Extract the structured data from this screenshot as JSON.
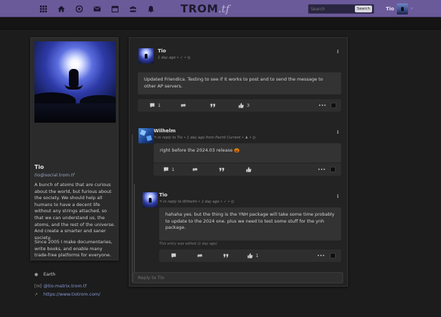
{
  "header": {
    "logo_main": "TROM",
    "logo_tld": ".tf",
    "nav_icons": [
      "grid-icon",
      "home-icon",
      "network-icon",
      "envelope-icon",
      "calendar-icon",
      "users-icon",
      "bell-icon"
    ],
    "search_placeholder": "Search",
    "search_button": "Search",
    "user_name": "Tio"
  },
  "profile": {
    "name": "Tio",
    "handle": "tio@social.trom.tf",
    "bio": "A bunch of atoms that are curious about the world, but furious about the society. We should help all humans to have a decent life without any strings attached, so that we can understand us, the atoms, and the rest of the universe. And create a smarter and saner society.",
    "bio2": "Since 2005 I make documentaries, write books, and enable many trade-free platforms for everyone.",
    "location": "Earth",
    "matrix": "@tio:matrix.trom.tf",
    "website": "https://www.tiotrom.com/"
  },
  "posts": [
    {
      "author": "Tio",
      "meta": "1 day ago • ✓ • ◎",
      "body": "Updated Friendica. Testing to see if it works to post and to send the message to other AP servers.",
      "comment_count": "1",
      "like_count": "3"
    },
    {
      "author": "Wilhelm",
      "meta": "↰ in reply to Tio • 1 day ago from Pachli Current • ♟ • ◎",
      "body": "right before the 2024.03 release 🎃",
      "comment_count": "1"
    },
    {
      "author": "Tio",
      "meta": "↰ in reply to Wilhelm • 1 day ago • ✓ • ◎",
      "body": "hahaha yes. but the thing is the YNH package will take some time probably to update to the 2024 one. plus we need to test some stuff for the ynh package.",
      "edited_note": "This entry was edited (1 day ago)",
      "like_count": "1"
    }
  ],
  "reply_placeholder": "Reply to Tio",
  "colors": {
    "topbar": "#6b5a9a",
    "page_bg": "#1c1c1c",
    "card_bg": "#2b2b2b",
    "link": "#8a9ad8"
  }
}
